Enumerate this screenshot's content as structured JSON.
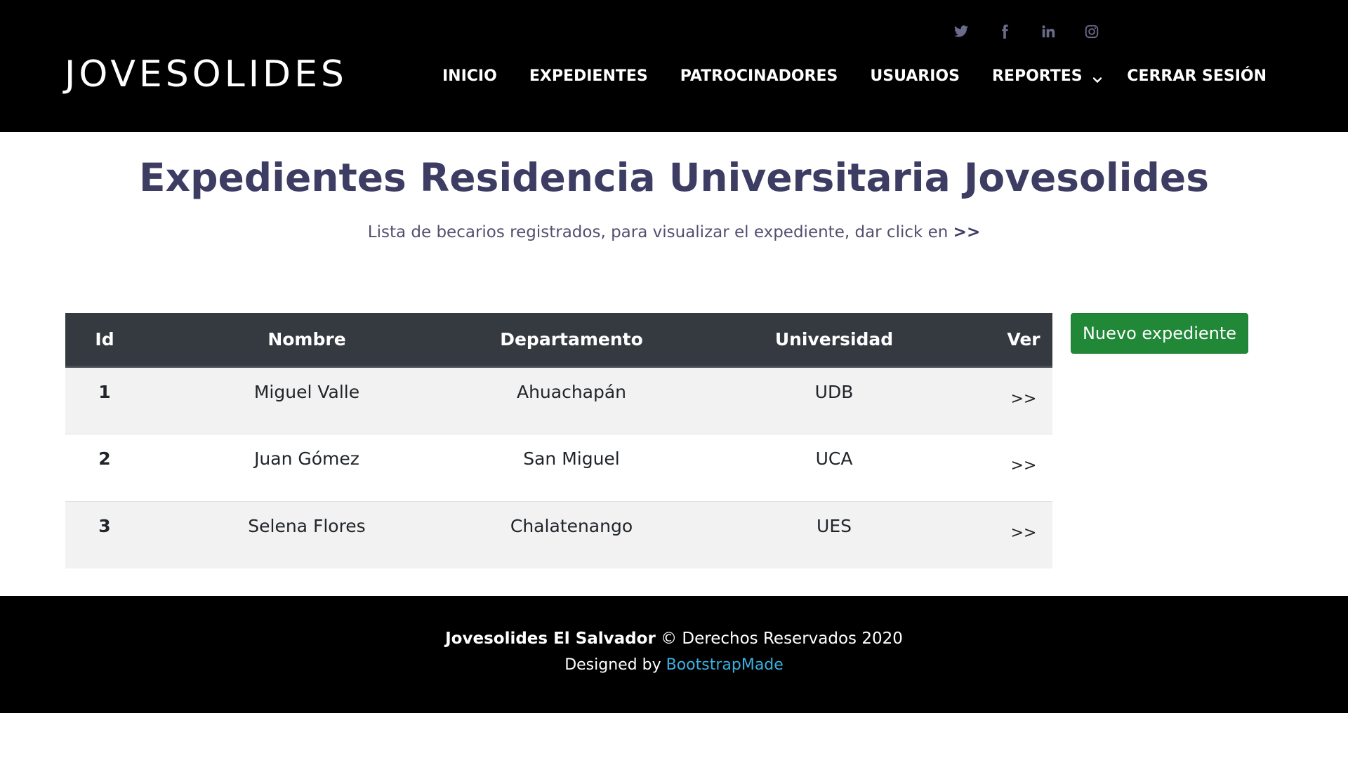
{
  "header": {
    "brand": "JOVESOLIDES",
    "social": [
      "twitter-icon",
      "facebook-icon",
      "linkedin-icon",
      "instagram-icon"
    ],
    "nav": [
      {
        "label": "INICIO"
      },
      {
        "label": "EXPEDIENTES"
      },
      {
        "label": "PATROCINADORES"
      },
      {
        "label": "USUARIOS"
      },
      {
        "label": "REPORTES",
        "dropdown": true
      }
    ],
    "logout": "CERRAR SESIÓN"
  },
  "main": {
    "title": "Expedientes Residencia Universitaria Jovesolides",
    "subtitle": "Lista de becarios registrados, para visualizar el expediente, dar click en",
    "subtitle_arrows": ">>",
    "new_button": "Nuevo expediente",
    "table": {
      "headers": [
        "Id",
        "Nombre",
        "Departamento",
        "Universidad",
        "Ver"
      ],
      "rows": [
        {
          "id": "1",
          "nombre": "Miguel Valle",
          "departamento": "Ahuachapán",
          "universidad": "UDB",
          "ver": ">>"
        },
        {
          "id": "2",
          "nombre": "Juan Gómez",
          "departamento": "San Miguel",
          "universidad": "UCA",
          "ver": ">>"
        },
        {
          "id": "3",
          "nombre": "Selena Flores",
          "departamento": "Chalatenango",
          "universidad": "UES",
          "ver": ">>"
        }
      ]
    }
  },
  "footer": {
    "company": "Jovesolides El Salvador",
    "rights": "© Derechos Reservados 2020",
    "designed_by_prefix": "Designed by",
    "designed_by_link": "BootstrapMade"
  },
  "colors": {
    "header_bg": "#000000",
    "title": "#3d3c63",
    "table_head": "#343a40",
    "button": "#218838",
    "link": "#3ab0e0"
  }
}
